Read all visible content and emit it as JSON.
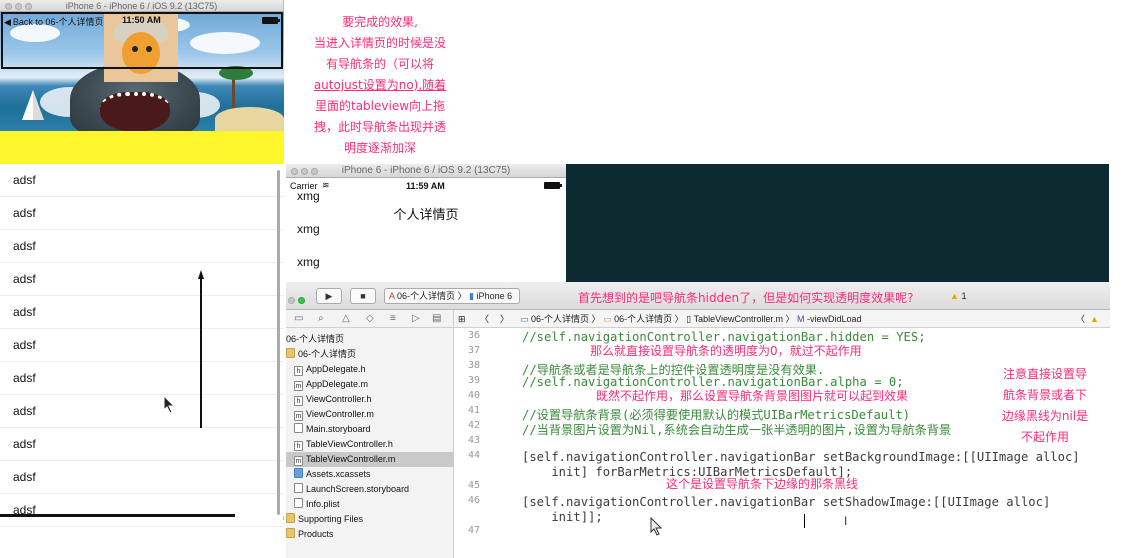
{
  "sim1": {
    "window_title": "iPhone 6 - iPhone 6 / iOS 9.2 (13C75)",
    "back_label": "Back to 06-个人详情页",
    "time": "11:50 AM",
    "rows": [
      "adsf",
      "adsf",
      "adsf",
      "adsf",
      "adsf",
      "adsf",
      "adsf",
      "adsf",
      "adsf",
      "adsf",
      "adsf"
    ]
  },
  "annotations": {
    "a1": [
      "要完成的效果,",
      "当进入详情页的时候是没",
      "有导航条的（可以将",
      "autojust设置为no),随着",
      "里面的tableview向上拖",
      "拽，此时导航条出现并透",
      "明度逐渐加深"
    ],
    "a2": "首先想到的是吧导航条hidden了，但是如何实现透明度效果呢?",
    "a3": "那么就直接设置导航条的透明度为0，就过不起作用",
    "a4": "既然不起作用，那么设置导航条背景图图片就可以起到效果",
    "a5": "这个是设置导航条下边缘的那条黑线",
    "a6": [
      "注意直接设置导",
      "航条背景或者下",
      "边缘黑线为nil是",
      "不起作用"
    ]
  },
  "sim2": {
    "window_title": "iPhone 6 - iPhone 6 / iOS 9.2 (13C75)",
    "carrier": "Carrier",
    "time": "11:59 AM",
    "nav_title": "个人详情页",
    "rows": [
      "xmg",
      "xmg",
      "xmg"
    ]
  },
  "xcode": {
    "scheme_target": "06-个人详情页",
    "scheme_device": "iPhone 6",
    "warning_count": "1",
    "path": {
      "project": "06-个人详情页",
      "group": "06-个人详情页",
      "file": "TableViewController.m",
      "method": "-viewDidLoad"
    },
    "navigator": [
      {
        "name": "06-个人详情页",
        "type": "project"
      },
      {
        "name": "06-个人详情页",
        "type": "folder"
      },
      {
        "name": "AppDelegate.h",
        "type": "h"
      },
      {
        "name": "AppDelegate.m",
        "type": "m"
      },
      {
        "name": "ViewController.h",
        "type": "h"
      },
      {
        "name": "ViewController.m",
        "type": "m"
      },
      {
        "name": "Main.storyboard",
        "type": "doc"
      },
      {
        "name": "TableViewController.h",
        "type": "h"
      },
      {
        "name": "TableViewController.m",
        "type": "m"
      },
      {
        "name": "Assets.xcassets",
        "type": "assets"
      },
      {
        "name": "LaunchScreen.storyboard",
        "type": "doc"
      },
      {
        "name": "Info.plist",
        "type": "doc"
      },
      {
        "name": "Supporting Files",
        "type": "folder"
      },
      {
        "name": "Products",
        "type": "folder"
      }
    ],
    "line_numbers": [
      "36",
      "37",
      "38",
      "39",
      "40",
      "41",
      "42",
      "43",
      "44",
      "",
      "45",
      "46",
      "",
      "47"
    ],
    "code": {
      "l36": "//self.navigationController.navigationBar.hidden = YES;",
      "l38": "//导航条或者是导航条上的控件设置透明度是没有效果.",
      "l39": "//self.navigationController.navigationBar.alpha = 0;",
      "l41": "//设置导航条背景(必须得要使用默认的模式UIBarMetricsDefault)",
      "l42": "//当背景图片设置为Nil,系统会自动生成一张半透明的图片,设置为导航条背景",
      "l44a": "[self.navigationController.navigationBar setBackgroundImage:[[UIImage alloc]",
      "l44b": "    init] forBarMetrics:UIBarMetricsDefault];",
      "l46a": "[self.navigationController.navigationBar setShadowImage:[[UIImage alloc]",
      "l46b": "    init]];"
    }
  }
}
